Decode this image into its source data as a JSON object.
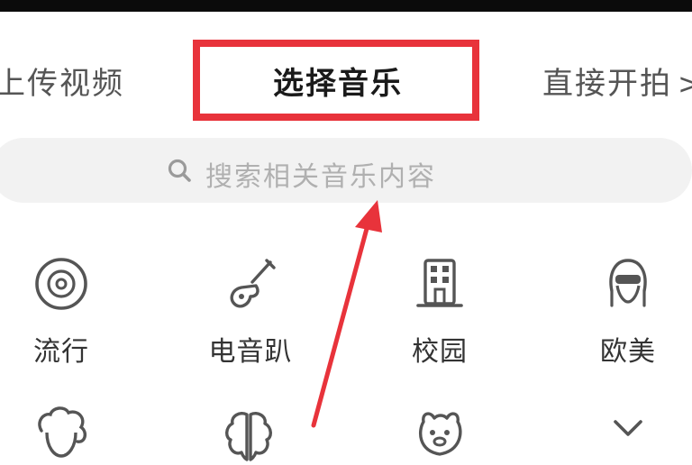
{
  "tabs": {
    "upload": "上传视频",
    "music": "选择音乐",
    "shoot": "直接开拍",
    "shoot_chevron": ">"
  },
  "search": {
    "placeholder": "搜索相关音乐内容",
    "icon": "search-icon"
  },
  "categories": [
    {
      "label": "流行",
      "icon": "disc-icon"
    },
    {
      "label": "电音趴",
      "icon": "guitar-icon"
    },
    {
      "label": "校园",
      "icon": "school-building-icon"
    },
    {
      "label": "欧美",
      "icon": "person-face-icon"
    }
  ],
  "categories_row2": [
    {
      "icon": "curly-hair-person-icon"
    },
    {
      "icon": "brain-icon"
    },
    {
      "icon": "cute-animal-icon"
    },
    {
      "icon": "chevron-down-icon"
    }
  ],
  "colors": {
    "highlight": "#e8333b",
    "search_bg": "#f2f2f2",
    "icon_stroke": "#555555"
  }
}
